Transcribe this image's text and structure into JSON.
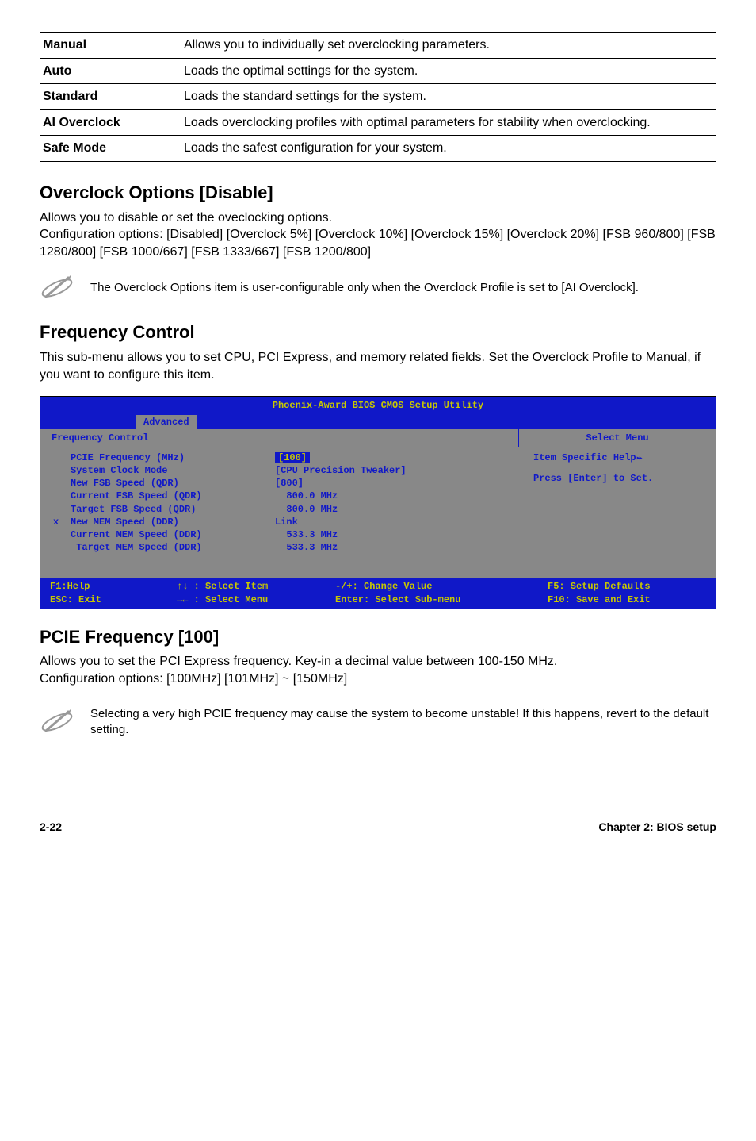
{
  "option_rows": [
    {
      "key": "Manual",
      "desc": "Allows you to individually set overclocking parameters."
    },
    {
      "key": "Auto",
      "desc": "Loads the optimal settings for the system."
    },
    {
      "key": "Standard",
      "desc": "Loads the standard settings for the system."
    },
    {
      "key": "AI Overclock",
      "desc": "Loads overclocking profiles with optimal parameters for stability when overclocking."
    },
    {
      "key": "Safe Mode",
      "desc": "Loads the safest configuration for your system."
    }
  ],
  "sections": {
    "overclock_options": {
      "title": "Overclock Options [Disable]",
      "p1": "Allows you to disable or set the oveclocking options.",
      "p2": "Configuration options: [Disabled] [Overclock 5%] [Overclock 10%] [Overclock 15%] [Overclock 20%] [FSB 960/800] [FSB 1280/800] [FSB 1000/667] [FSB 1333/667] [FSB 1200/800]",
      "note": "The Overclock Options item is user-configurable only when the Overclock Profile is set to [AI Overclock]."
    },
    "frequency_control": {
      "title": "Frequency Control",
      "p1": "This sub-menu allows you to set CPU, PCI Express, and memory related fields. Set the Overclock Profile to Manual, if you want to configure this item."
    },
    "pcie_frequency": {
      "title": "PCIE Frequency [100]",
      "p1": "Allows you to set the PCI Express frequency. Key-in a decimal value between 100-150 MHz.",
      "p2": "Configuration options: [100MHz] [101MHz] ~ [150MHz]",
      "note": "Selecting a very high PCIE frequency may cause the system to become unstable! If this happens, revert to the default setting."
    }
  },
  "bios": {
    "title": "Phoenix-Award BIOS CMOS Setup Utility",
    "tab": "Advanced",
    "section_title": "Frequency Control",
    "right_header": "Select Menu",
    "help_title": "Item Specific Help",
    "help_text": "Press [Enter] to Set.",
    "rows": [
      {
        "mark": "",
        "label": "PCIE Frequency (MHz)",
        "value": "[100]",
        "hilite": true
      },
      {
        "mark": "",
        "label": "",
        "value": ""
      },
      {
        "mark": "",
        "label": "System Clock Mode",
        "value": "[CPU Precision Tweaker]"
      },
      {
        "mark": "",
        "label": "New FSB Speed (QDR)",
        "value": "[800]"
      },
      {
        "mark": "",
        "label": "Current FSB Speed (QDR)",
        "value": "  800.0 MHz"
      },
      {
        "mark": "",
        "label": "Target FSB Speed (QDR)",
        "value": "  800.0 MHz"
      },
      {
        "mark": "",
        "label": "",
        "value": ""
      },
      {
        "mark": "x",
        "label": "New MEM Speed (DDR)",
        "value": "Link"
      },
      {
        "mark": "",
        "label": "Current MEM Speed (DDR)",
        "value": "  533.3 MHz"
      },
      {
        "mark": "",
        "label": " Target MEM Speed (DDR)",
        "value": "  533.3 MHz"
      }
    ],
    "footer": {
      "help": "F1:Help",
      "select_item": "↑↓ : Select Item",
      "change": "-/+: Change Value",
      "defaults": "F5: Setup Defaults",
      "exit": "ESC: Exit",
      "select_menu": "→← : Select Menu",
      "enter": "Enter: Select Sub-menu",
      "save": "F10: Save and Exit"
    }
  },
  "footer": {
    "left": "2-22",
    "right": "Chapter 2: BIOS setup"
  }
}
